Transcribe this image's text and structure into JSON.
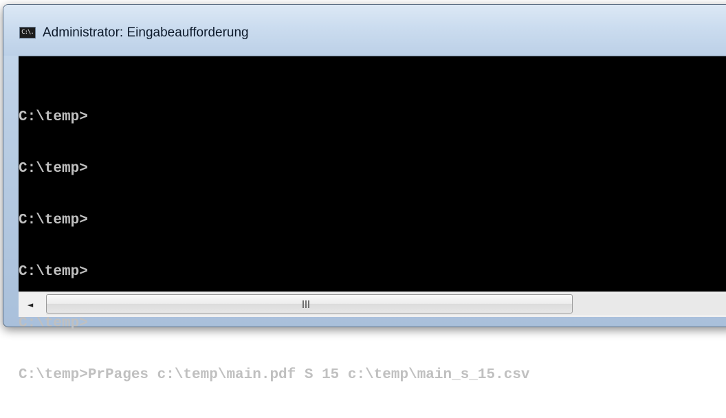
{
  "window": {
    "title": "Administrator: Eingabeaufforderung",
    "icon": "cmd-icon",
    "icon_text": "C:\\."
  },
  "console": {
    "lines": [
      "C:\\temp>",
      "C:\\temp>",
      "C:\\temp>",
      "C:\\temp>",
      "C:\\temp>",
      "C:\\temp>PrPages c:\\temp\\main.pdf S 15 c:\\temp\\main_s_15.csv"
    ],
    "foreground": "#c0c0c0",
    "background": "#000000"
  },
  "scrollbar": {
    "left_arrow": "◄",
    "left_arrow_icon": "arrow-left-icon",
    "thumb_grip_icon": "grip-icon"
  }
}
